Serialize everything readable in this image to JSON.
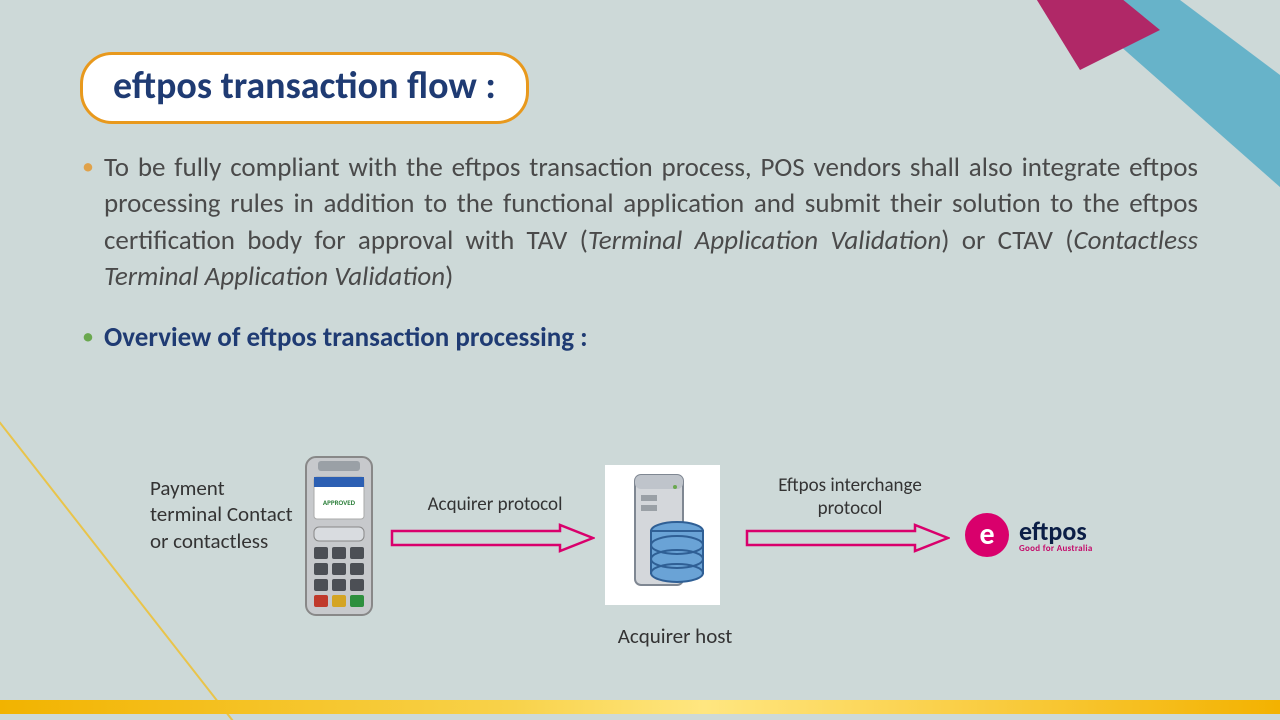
{
  "title": "eftpos transaction flow :",
  "bullets": {
    "main_pre": "To be fully compliant with the eftpos transaction process, POS vendors shall also integrate eftpos processing rules in addition to the functional application and submit their solution to the eftpos certification body for approval with TAV (",
    "main_ital1": "Terminal Application Validation",
    "main_mid": ") or CTAV (",
    "main_ital2": "Contactless Terminal Application Validation",
    "main_post": ")",
    "subhead": "Overview of eftpos transaction processing :"
  },
  "flow": {
    "terminal_label": "Payment terminal Contact or contactless",
    "terminal_screen": "APPROVED",
    "acquirer_protocol": "Acquirer protocol",
    "interchange_protocol": "Eftpos interchange protocol",
    "acquirer_host": "Acquirer host"
  },
  "eftpos_logo": {
    "e": "e",
    "word": "eftpos",
    "tag": "Good for Australia"
  },
  "colors": {
    "arrow": "#d9006c",
    "title_border": "#e8991d",
    "heading": "#1f3b73"
  }
}
